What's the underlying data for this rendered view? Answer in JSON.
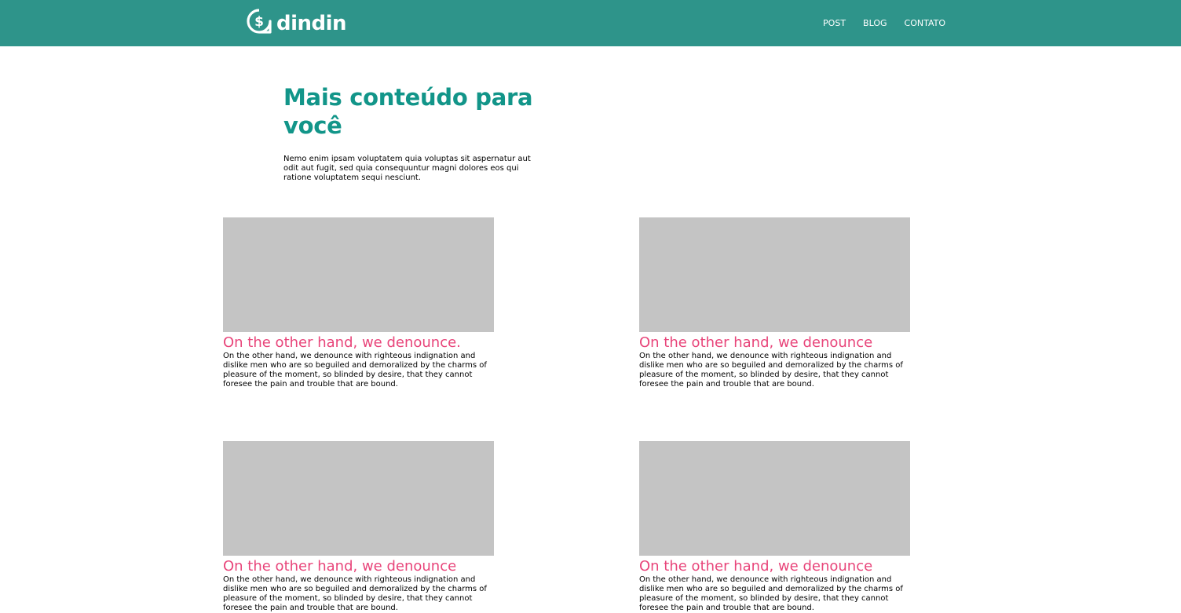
{
  "brand": {
    "name": "dindin",
    "bar_color": "#2e948a",
    "logo_icon": "dollar-chat-bubble-icon"
  },
  "nav": {
    "items": [
      {
        "label": "POST"
      },
      {
        "label": "BLOG"
      },
      {
        "label": "CONTATO"
      }
    ]
  },
  "intro": {
    "title": "Mais conteúdo para você",
    "text": "Nemo enim ipsam voluptatem quia voluptas sit aspernatur aut odit aut fugit, sed quia consequuntur magni dolores eos qui ratione voluptatem sequi nesciunt."
  },
  "cards": [
    {
      "title": "On the other hand, we denounce.",
      "text": "On the other hand, we denounce with righteous indignation and dislike men who are so beguiled and demoralized by the charms of pleasure of the moment, so blinded by desire, that they cannot foresee the pain and trouble that are bound."
    },
    {
      "title": "On the other hand, we denounce",
      "text": "On the other hand, we denounce with righteous indignation and dislike men who are so beguiled and demoralized by the charms of pleasure of the moment, so blinded by desire, that they cannot foresee the pain and trouble that are bound."
    },
    {
      "title": "On the other hand, we denounce",
      "text": "On the other hand, we denounce with righteous indignation and dislike men who are so beguiled and demoralized by the charms of pleasure of the moment, so blinded by desire, that they cannot foresee the pain and trouble that are bound."
    },
    {
      "title": "On the other hand, we denounce",
      "text": "On the other hand, we denounce with righteous indignation and dislike men who are so beguiled and demoralized by the charms of pleasure of the moment, so blinded by desire, that they cannot foresee the pain and trouble that are bound."
    }
  ],
  "colors": {
    "title_teal": "#129589",
    "card_title_pink": "#e8457a",
    "placeholder_gray": "#c4c4c4"
  }
}
